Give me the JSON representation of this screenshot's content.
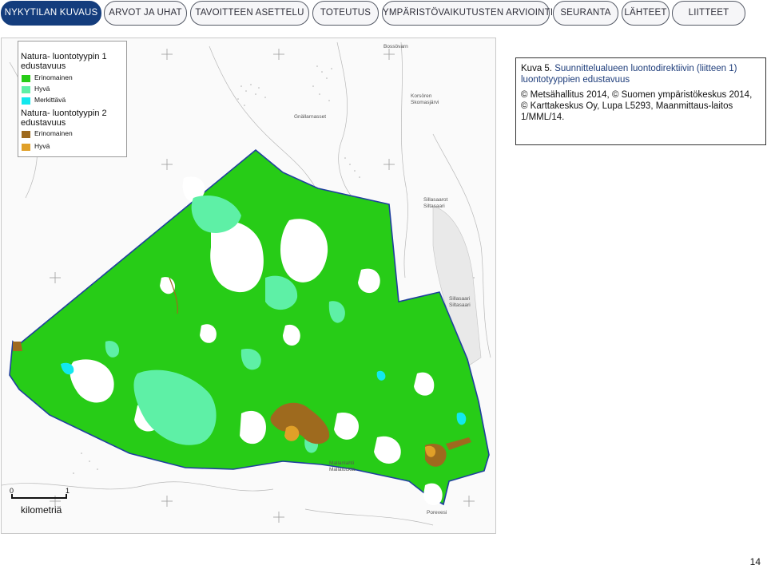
{
  "nav": {
    "tabs": [
      {
        "label": "NYKYTILAN KUVAUS",
        "active": true
      },
      {
        "label": "ARVOT JA UHAT",
        "active": false
      },
      {
        "label": "TAVOITTEEN ASETTELU",
        "active": false
      },
      {
        "label": "TOTEUTUS",
        "active": false
      },
      {
        "label": "YMPÄRISTÖVAIKUTUSTEN ARVIOINTI",
        "active": false
      },
      {
        "label": "SEURANTA",
        "active": false
      },
      {
        "label": "LÄHTEET",
        "active": false
      },
      {
        "label": "LIITTEET",
        "active": false
      }
    ]
  },
  "legend": {
    "group1_title": "Natura- luontotyypin 1 edustavuus",
    "group1_items": [
      {
        "label": "Erinomainen",
        "color": "#27cc17"
      },
      {
        "label": "Hyvä",
        "color": "#5ef0a6"
      },
      {
        "label": "Merkittävä",
        "color": "#12e8ee"
      }
    ],
    "group2_title": "Natura- luontotyypin 2 edustavuus",
    "group2_items": [
      {
        "label": "Erinomainen",
        "color": "#9e6a1e"
      },
      {
        "label": "Hyvä",
        "color": "#e0a028"
      }
    ]
  },
  "caption": {
    "label": "Kuva 5.",
    "text": " Suunnittelualueen luontodirektiivin (liitteen 1) luontotyyppien edustavuus",
    "copyright": "© Metsähallitus 2014, © Suomen ympäristökeskus 2014, © Karttakeskus Oy, Lupa L5293, Maanmittaus-laitos 1/MML/14."
  },
  "map": {
    "place_names": [
      "Bossövarn",
      "Korsören Skomasjärvi",
      "Gnällarnasset",
      "Sillasaarot Siltasaari",
      "Sillasaari Siltasaari",
      "Mallanlahti Mallaluckta",
      "Porevesi"
    ],
    "colors": {
      "boundary": "#1f3f9e",
      "area": "#27cc17",
      "good": "#5ef0a6",
      "significant": "#12e8ee",
      "type2_excellent": "#9e6a1e",
      "type2_good": "#e0a028"
    }
  },
  "scalebar": {
    "start": "0",
    "end": "1",
    "unit": "kilometriä"
  },
  "page_number": "14"
}
